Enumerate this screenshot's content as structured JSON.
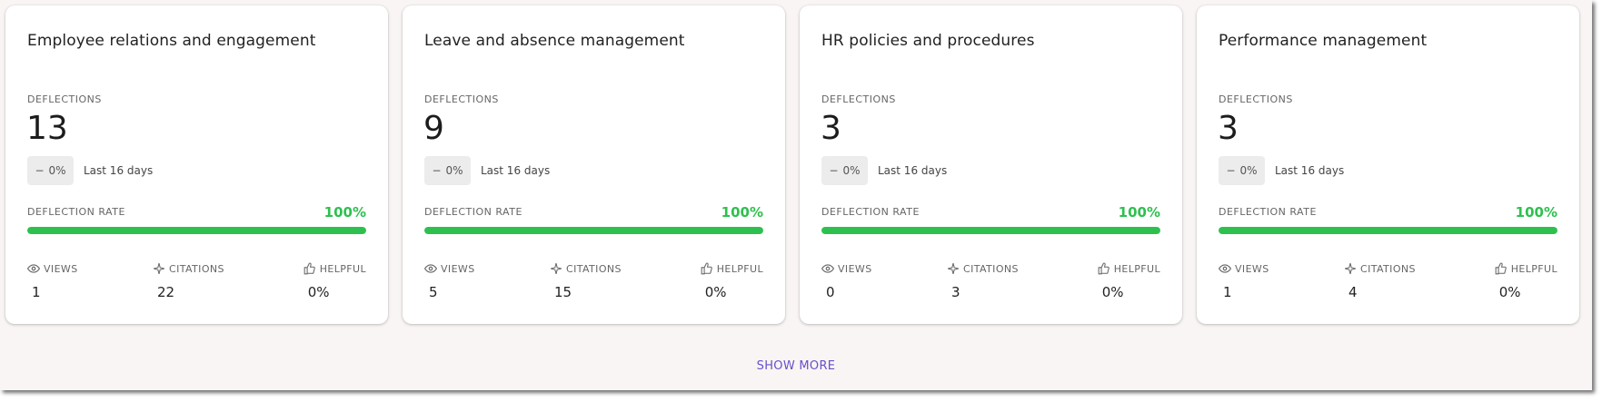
{
  "cards": [
    {
      "title": "Employee relations and engagement",
      "deflections_label": "DEFLECTIONS",
      "deflections_value": "13",
      "trend_value": "0%",
      "trend_period": "Last 16 days",
      "rate_label": "DEFLECTION RATE",
      "rate_value": "100%",
      "rate_fraction": 1.0,
      "views_label": "VIEWS",
      "views_value": "1",
      "citations_label": "CITATIONS",
      "citations_value": "22",
      "helpful_label": "HELPFUL",
      "helpful_value": "0%"
    },
    {
      "title": "Leave and absence management",
      "deflections_label": "DEFLECTIONS",
      "deflections_value": "9",
      "trend_value": "0%",
      "trend_period": "Last 16 days",
      "rate_label": "DEFLECTION RATE",
      "rate_value": "100%",
      "rate_fraction": 1.0,
      "views_label": "VIEWS",
      "views_value": "5",
      "citations_label": "CITATIONS",
      "citations_value": "15",
      "helpful_label": "HELPFUL",
      "helpful_value": "0%"
    },
    {
      "title": "HR policies and procedures",
      "deflections_label": "DEFLECTIONS",
      "deflections_value": "3",
      "trend_value": "0%",
      "trend_period": "Last 16 days",
      "rate_label": "DEFLECTION RATE",
      "rate_value": "100%",
      "rate_fraction": 1.0,
      "views_label": "VIEWS",
      "views_value": "0",
      "citations_label": "CITATIONS",
      "citations_value": "3",
      "helpful_label": "HELPFUL",
      "helpful_value": "0%"
    },
    {
      "title": "Performance management",
      "deflections_label": "DEFLECTIONS",
      "deflections_value": "3",
      "trend_value": "0%",
      "trend_period": "Last 16 days",
      "rate_label": "DEFLECTION RATE",
      "rate_value": "100%",
      "rate_fraction": 1.0,
      "views_label": "VIEWS",
      "views_value": "1",
      "citations_label": "CITATIONS",
      "citations_value": "4",
      "helpful_label": "HELPFUL",
      "helpful_value": "0%"
    }
  ],
  "show_more_label": "SHOW MORE",
  "colors": {
    "accent_green": "#2ec04f",
    "link_purple": "#6a4fc8"
  },
  "icons": {
    "views": "eye-icon",
    "citations": "sparkle-icon",
    "helpful": "thumbs-up-icon",
    "trend": "dash-icon"
  }
}
